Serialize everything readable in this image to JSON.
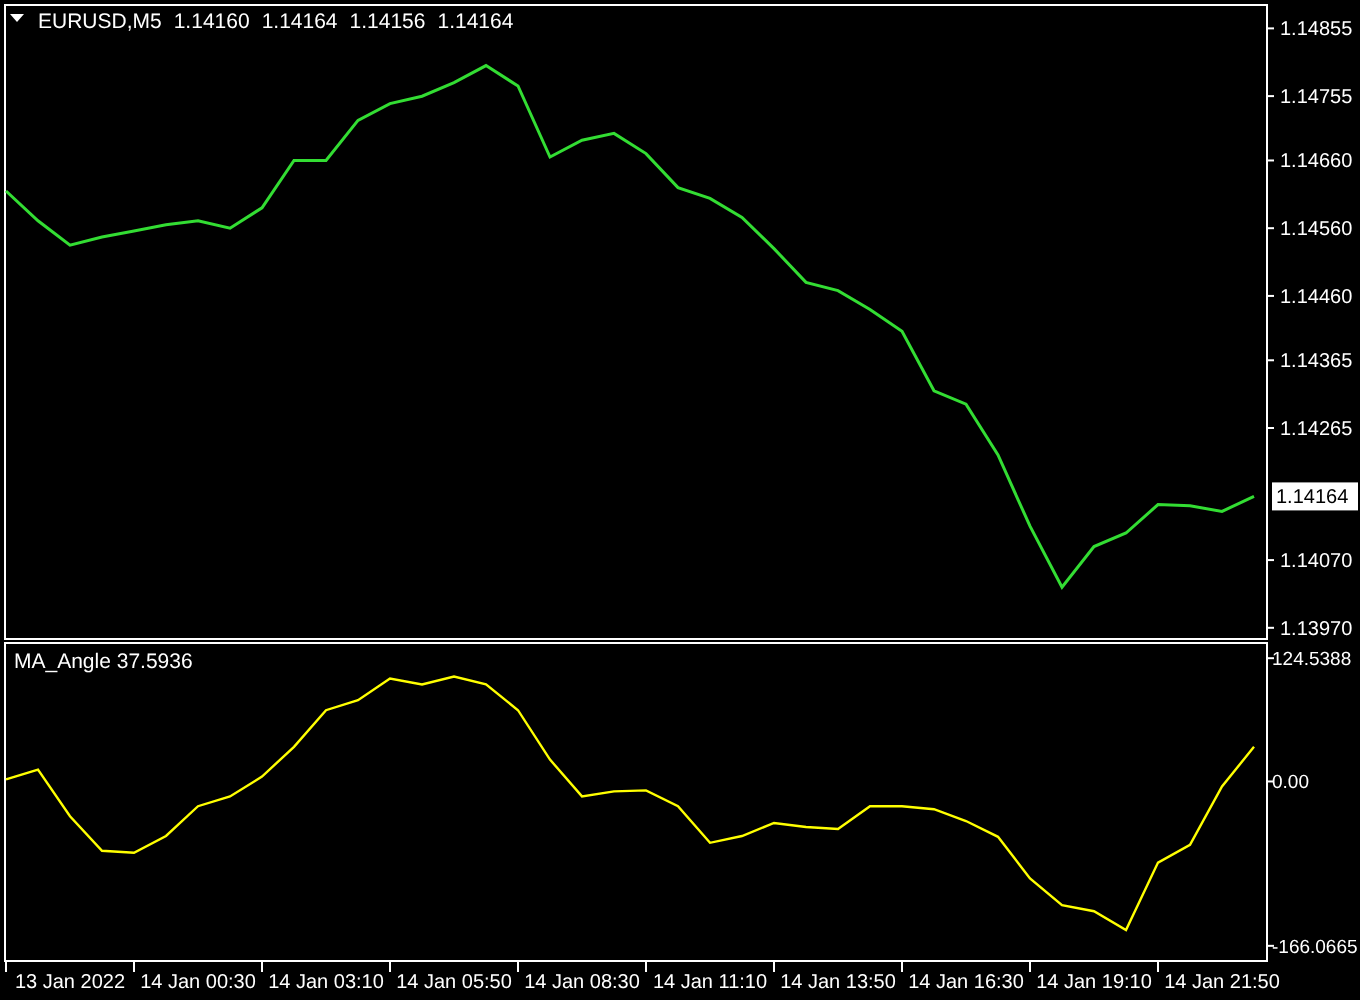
{
  "price_panel": {
    "symbol": "EURUSD,M5",
    "quotes": [
      "1.14160",
      "1.14164",
      "1.14156",
      "1.14164"
    ],
    "current_price": "1.14164",
    "chart_data": {
      "type": "line",
      "ylim": [
        1.13952,
        1.14891
      ],
      "categories": [
        null,
        null,
        null,
        null,
        null,
        null,
        null,
        null,
        null,
        null,
        null,
        null,
        null,
        null,
        null,
        null,
        null,
        null,
        null,
        null,
        null,
        null,
        null,
        null,
        null,
        null,
        null,
        null,
        null,
        null,
        null,
        null,
        null,
        null,
        null,
        null,
        null,
        null,
        null,
        null
      ],
      "series": [
        {
          "color": "#33dd33",
          "values": [
            1.14615,
            1.14571,
            1.14535,
            1.14547,
            1.14556,
            1.14565,
            1.14571,
            1.1456,
            1.1459,
            1.1466,
            1.1466,
            1.14719,
            1.14744,
            1.14755,
            1.14775,
            1.148,
            1.1477,
            1.14665,
            1.1469,
            1.147,
            1.1467,
            1.1462,
            1.14604,
            1.14576,
            1.1453,
            1.1448,
            1.14468,
            1.1444,
            1.14408,
            1.1432,
            1.143,
            1.14225,
            1.1412,
            1.1403,
            1.1409,
            1.1411,
            1.14152,
            1.1415,
            1.14142,
            1.14164
          ]
        }
      ],
      "yticks": [
        {
          "value": 1.14855,
          "label": "1.14855"
        },
        {
          "value": 1.14755,
          "label": "1.14755"
        },
        {
          "value": 1.1466,
          "label": "1.14660"
        },
        {
          "value": 1.1456,
          "label": "1.14560"
        },
        {
          "value": 1.1446,
          "label": "1.14460"
        },
        {
          "value": 1.14365,
          "label": "1.14365"
        },
        {
          "value": 1.14265,
          "label": "1.14265"
        },
        {
          "value": 1.1407,
          "label": "1.14070"
        },
        {
          "value": 1.1397,
          "label": "1.13970"
        }
      ]
    }
  },
  "indicator_panel": {
    "label": "MA_Angle 37.5936",
    "chart_data": {
      "type": "line",
      "ylim": [
        -182.4,
        140.9
      ],
      "categories": [
        null,
        null,
        "13 Jan 2022",
        null,
        null,
        null,
        "14 Jan 00:30",
        null,
        null,
        null,
        "14 Jan 03:10",
        null,
        null,
        null,
        "14 Jan 05:50",
        null,
        null,
        null,
        "14 Jan 08:30",
        null,
        null,
        null,
        "14 Jan 11:10",
        null,
        null,
        null,
        "14 Jan 13:50",
        null,
        null,
        null,
        "14 Jan 16:30",
        null,
        null,
        null,
        "14 Jan 19:10",
        null,
        null,
        null,
        "14 Jan 21:50",
        null
      ],
      "series": [
        {
          "color": "#ffff00",
          "values": [
            2,
            12,
            -35,
            -70,
            -72,
            -55,
            -25,
            -15,
            5,
            35,
            72,
            82,
            104,
            98,
            106,
            98,
            72,
            22,
            -15,
            -10,
            -9,
            -25,
            -62,
            -55,
            -42,
            -46,
            -48,
            -25,
            -25,
            -28,
            -40,
            -56,
            -98,
            -125,
            -131,
            -150,
            -82,
            -64,
            -5,
            35
          ]
        }
      ],
      "yticks": [
        {
          "value": 124.5388,
          "label": "124.5388"
        },
        {
          "value": 0,
          "label": "0.00"
        },
        {
          "value": -166.0665,
          "label": "-166.0665"
        }
      ]
    }
  }
}
